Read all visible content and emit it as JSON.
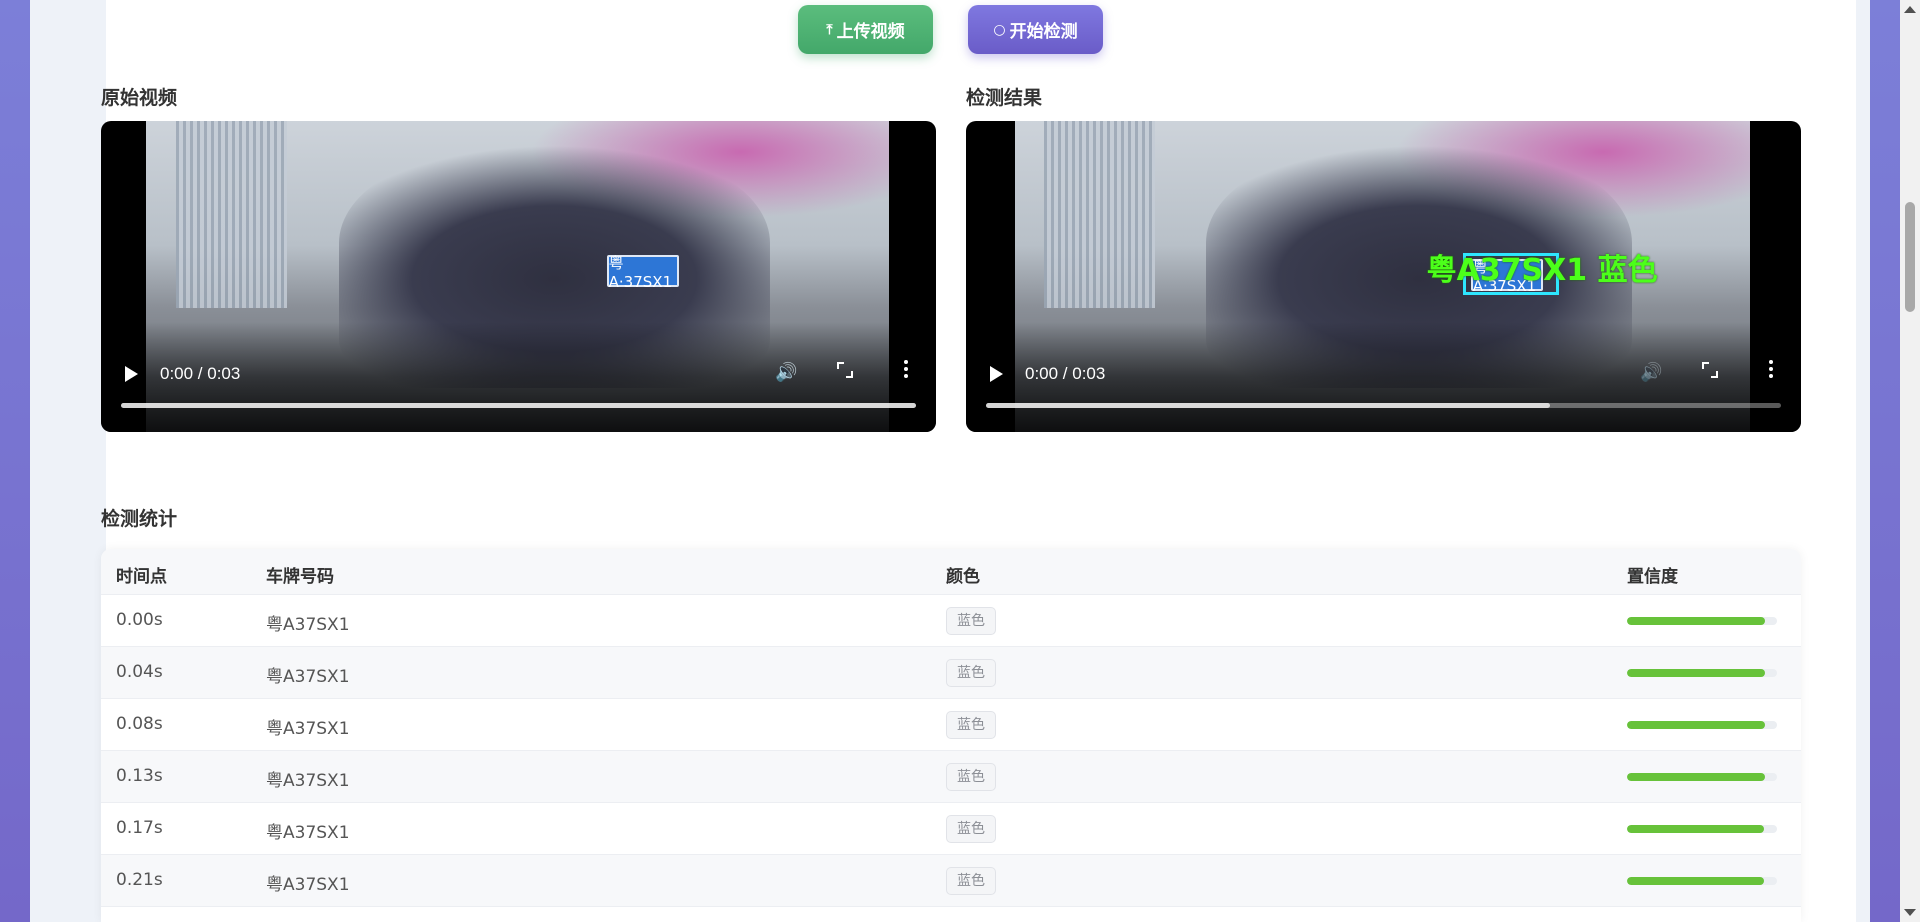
{
  "toolbar": {
    "upload_label": "上传视频",
    "detect_label": "开始检测"
  },
  "original_video": {
    "title": "原始视频",
    "time": "0:00 / 0:03",
    "plate_text": "粤A·37SX1",
    "progress": 0.0
  },
  "result_video": {
    "title": "检测结果",
    "time": "0:00 / 0:03",
    "plate_text": "粤A·37SX1",
    "overlay_label": "粤A37SX1 蓝色",
    "progress": 0.0
  },
  "stats": {
    "title": "检测统计",
    "headers": {
      "time": "时间点",
      "plate": "车牌号码",
      "color": "颜色",
      "confidence": "置信度"
    },
    "rows": [
      {
        "time": "0.00s",
        "plate": "粤A37SX1",
        "color": "蓝色",
        "confidence": 0.92
      },
      {
        "time": "0.04s",
        "plate": "粤A37SX1",
        "color": "蓝色",
        "confidence": 0.92
      },
      {
        "time": "0.08s",
        "plate": "粤A37SX1",
        "color": "蓝色",
        "confidence": 0.92
      },
      {
        "time": "0.13s",
        "plate": "粤A37SX1",
        "color": "蓝色",
        "confidence": 0.92
      },
      {
        "time": "0.17s",
        "plate": "粤A37SX1",
        "color": "蓝色",
        "confidence": 0.91
      },
      {
        "time": "0.21s",
        "plate": "粤A37SX1",
        "color": "蓝色",
        "confidence": 0.91
      }
    ]
  },
  "colors": {
    "upload_button": "#4caf70",
    "detect_button": "#7066d2",
    "confidence_bar": "#67c23a",
    "detection_box": "#2ee6ff",
    "overlay_text": "#4cff1a"
  }
}
